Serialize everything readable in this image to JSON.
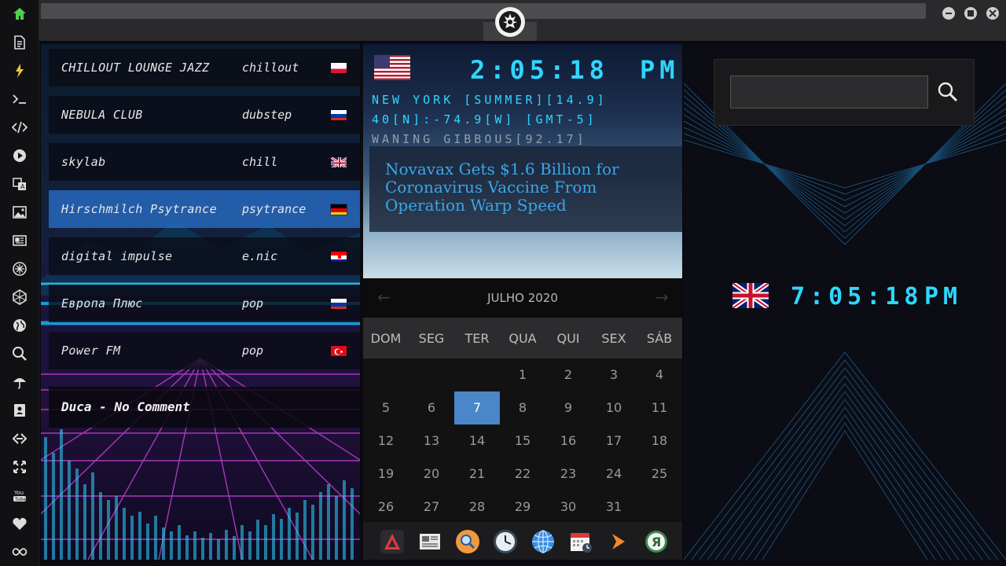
{
  "sidebar": {
    "icons": [
      "home-icon",
      "document-icon",
      "lightning-icon",
      "terminal-icon",
      "code-icon",
      "play-icon",
      "translate-icon",
      "image-icon",
      "newspaper-icon",
      "sun-icon",
      "hexagon-icon",
      "globe-icon",
      "search-icon",
      "umbrella-icon",
      "contacts-icon",
      "link-icon",
      "fullscreen-icon",
      "youtube-icon",
      "heart-icon",
      "infinity-icon"
    ]
  },
  "radio": {
    "stations": [
      {
        "name": "CHILLOUT LOUNGE JAZZ",
        "genre": "chillout",
        "flag": "poland"
      },
      {
        "name": "NEBULA CLUB",
        "genre": "dubstep",
        "flag": "russia"
      },
      {
        "name": "skylab",
        "genre": "chill",
        "flag": "uk"
      },
      {
        "name": "Hirschmilch Psytrance",
        "genre": "psytrance",
        "flag": "germany"
      },
      {
        "name": "digital impulse",
        "genre": "e.nic",
        "flag": "croatia"
      },
      {
        "name": "Европа Плюс",
        "genre": "pop",
        "flag": "russia"
      },
      {
        "name": "Power FM",
        "genre": "pop",
        "flag": "turkey"
      }
    ],
    "now_playing": "Duca - No Comment"
  },
  "clock_ny": {
    "time": "2:05:18",
    "ampm": "PM",
    "location_line": "NEW YORK [SUMMER][14.9]",
    "coords_line": "40[N]:-74.9[W] [GMT-5]",
    "moon_line": "WANING GIBBOUS[92.17]"
  },
  "news": {
    "headline": "Novavax Gets $1.6 Billion for Coronavirus Vaccine From Operation Warp Speed"
  },
  "calendar": {
    "month_label": "JULHO 2020",
    "weekdays": [
      "DOM",
      "SEG",
      "TER",
      "QUA",
      "QUI",
      "SEX",
      "SÁB"
    ],
    "first_weekday": 3,
    "days_in_month": 31,
    "today": 7
  },
  "dock": {
    "icons": [
      "app-a-icon",
      "news-icon",
      "search-icon",
      "clock-icon",
      "globe-icon",
      "calendar-icon",
      "arrow-icon",
      "ya-icon"
    ]
  },
  "right_panel": {
    "search_placeholder": "",
    "clock_uk": {
      "time": "7:05:18",
      "ampm": "PM"
    }
  },
  "colors": {
    "lcd": "#2fd6ff",
    "accent": "#4a86c8",
    "news_link": "#3aa6e8"
  }
}
